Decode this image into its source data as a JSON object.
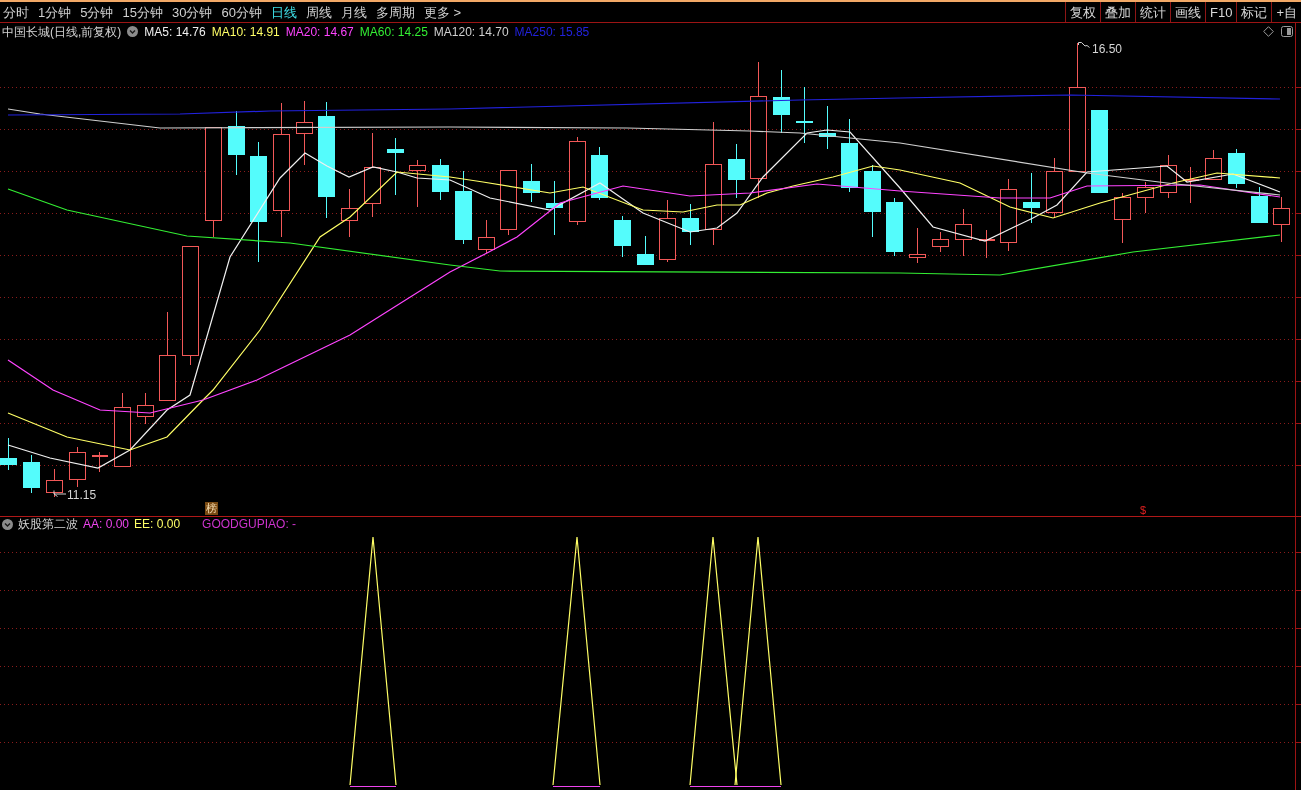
{
  "toolbar": {
    "periods": [
      {
        "label": "分时",
        "selected": false
      },
      {
        "label": "1分钟",
        "selected": false
      },
      {
        "label": "5分钟",
        "selected": false
      },
      {
        "label": "15分钟",
        "selected": false
      },
      {
        "label": "30分钟",
        "selected": false
      },
      {
        "label": "60分钟",
        "selected": false
      },
      {
        "label": "日线",
        "selected": true
      },
      {
        "label": "周线",
        "selected": false
      },
      {
        "label": "月线",
        "selected": false
      },
      {
        "label": "多周期",
        "selected": false
      },
      {
        "label": "更多 >",
        "selected": false
      }
    ],
    "buttons": [
      "复权",
      "叠加",
      "统计",
      "画线",
      "F10",
      "标记",
      "+自"
    ]
  },
  "main_chart": {
    "title": "中国长城(日线,前复权)",
    "indicators": [
      {
        "label": "MA5: 14.76",
        "color": "#f0f0f0"
      },
      {
        "label": "MA10: 14.91",
        "color": "#ffff66"
      },
      {
        "label": "MA20: 14.67",
        "color": "#ff44ff"
      },
      {
        "label": "MA60: 14.25",
        "color": "#33ee33"
      },
      {
        "label": "MA120: 14.70",
        "color": "#d0d0d0"
      },
      {
        "label": "MA250: 15.85",
        "color": "#2222dd"
      }
    ],
    "high_label": "16.50",
    "low_label": "11.15",
    "markers": [
      {
        "kind": "badge",
        "text": "榜"
      },
      {
        "kind": "sign",
        "text": "$"
      }
    ]
  },
  "sub_chart": {
    "title": "妖股第二波",
    "indicators": [
      {
        "label": "AA: 0.00",
        "color": "#ee44ee"
      },
      {
        "label": "EE: 0.00",
        "color": "#ffff66"
      },
      {
        "label": "GOODGUPIAO: -",
        "color": "#cc33cc"
      }
    ]
  }
}
